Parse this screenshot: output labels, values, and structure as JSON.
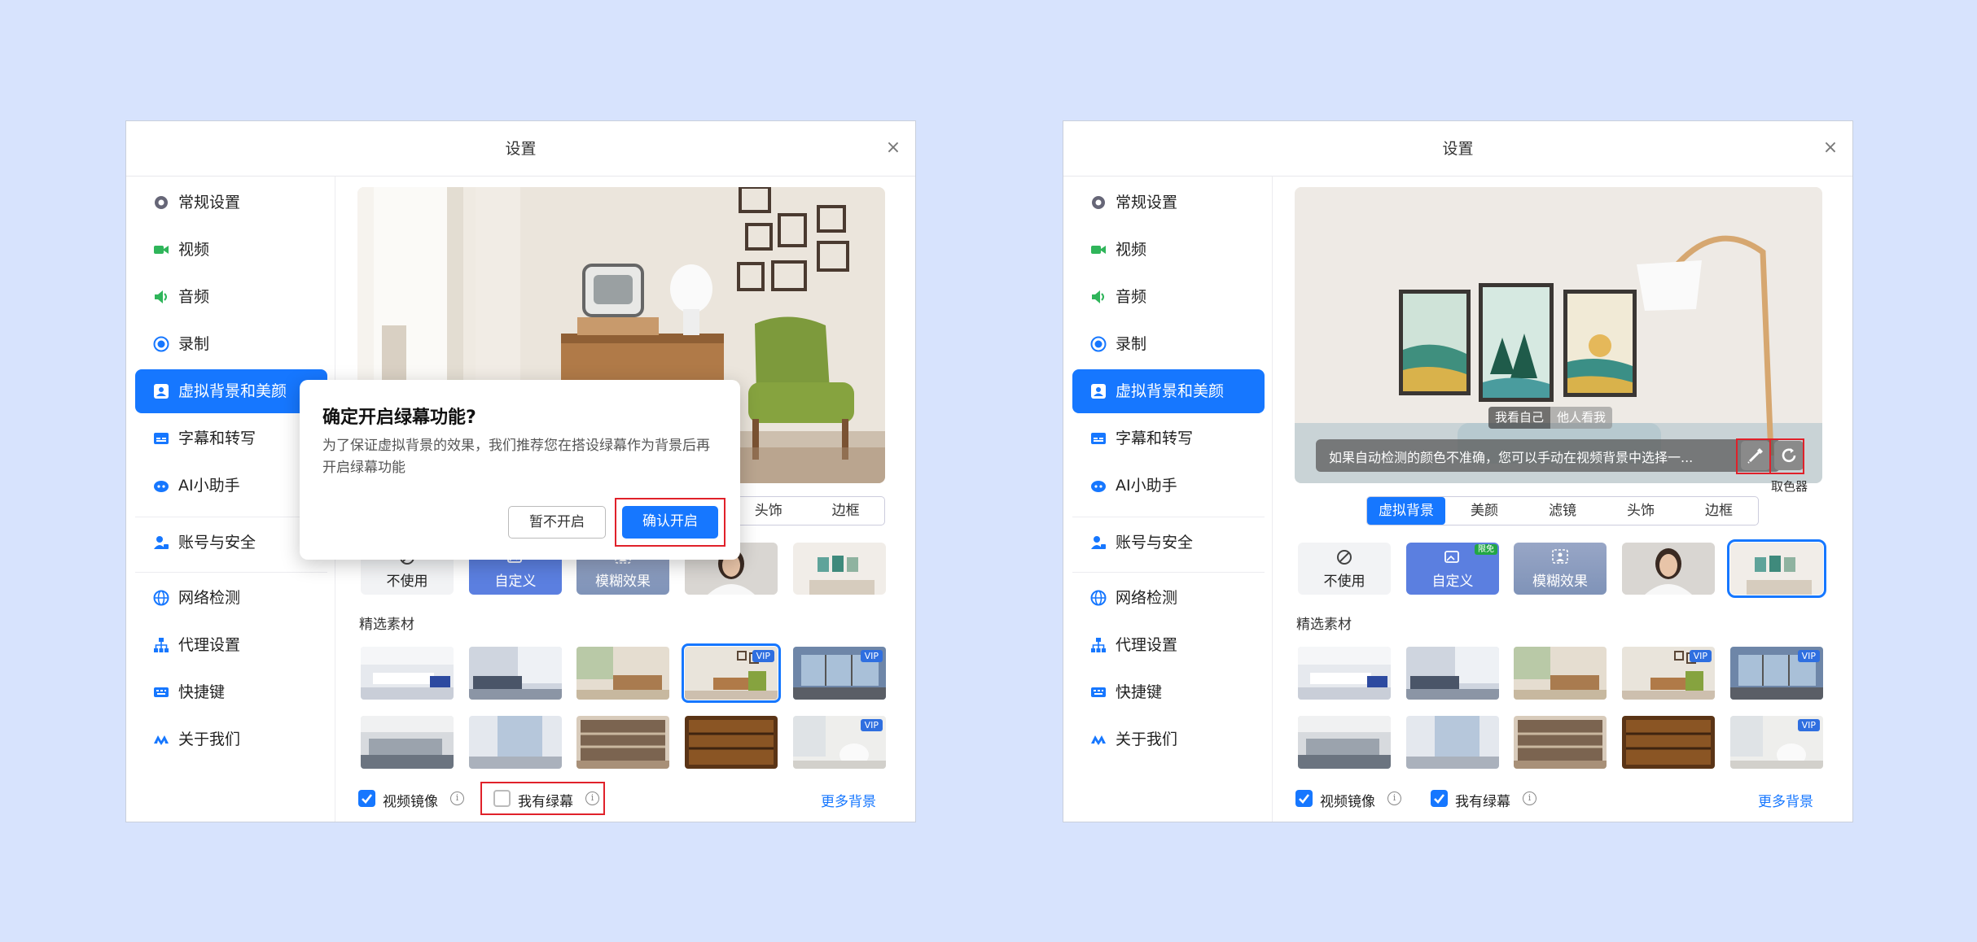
{
  "window_title": "设置",
  "close_glyph": "×",
  "sidebar": {
    "items": [
      {
        "label": "常规设置",
        "icon": "gear-icon"
      },
      {
        "label": "视频",
        "icon": "video-camera-icon"
      },
      {
        "label": "音频",
        "icon": "speaker-icon"
      },
      {
        "label": "录制",
        "icon": "record-icon"
      },
      {
        "label": "虚拟背景和美颜",
        "icon": "portrait-icon"
      },
      {
        "label": "字幕和转写",
        "icon": "subtitle-icon"
      },
      {
        "label": "AI小助手",
        "icon": "ai-assistant-icon"
      },
      {
        "label": "账号与安全",
        "icon": "account-security-icon"
      },
      {
        "label": "网络检测",
        "icon": "globe-icon"
      },
      {
        "label": "代理设置",
        "icon": "proxy-icon"
      },
      {
        "label": "快捷键",
        "icon": "keyboard-icon"
      },
      {
        "label": "关于我们",
        "icon": "about-logo-icon"
      }
    ],
    "active_index": 4
  },
  "tabs": [
    "虚拟背景",
    "美颜",
    "滤镜",
    "头饰",
    "边框"
  ],
  "options": {
    "none": "不使用",
    "custom": "自定义",
    "blur": "模糊效果",
    "custom_badge": "限免"
  },
  "section_title": "精选素材",
  "vip_badge": "VIP",
  "bottom": {
    "mirror_label": "视频镜像",
    "green_label": "我有绿幕",
    "more_label": "更多背景"
  },
  "dialog": {
    "title": "确定开启绿幕功能?",
    "message": "为了保证虚拟背景的效果，我们推荐您在搭设绿幕作为背景后再开启绿幕功能",
    "cancel_label": "暂不开启",
    "confirm_label": "确认开启"
  },
  "preview_right": {
    "toggle_self": "我看自己",
    "toggle_others": "他人看我",
    "hint": "如果自动检测的颜色不准确，您可以手动在视频背景中选择一...",
    "tooltip": "取色器"
  },
  "left_state": {
    "active_tab_index": null,
    "mirror_checked": true,
    "green_checked": false,
    "selected_tile_index": 3
  },
  "right_state": {
    "active_tab_index": 0,
    "mirror_checked": true,
    "green_checked": true,
    "selected_option": "image-white-room"
  },
  "colors": {
    "accent": "#1677ff",
    "page_bg": "#d7e3fd",
    "highlight_red": "#e0212a",
    "free_badge_green": "#22a745"
  }
}
